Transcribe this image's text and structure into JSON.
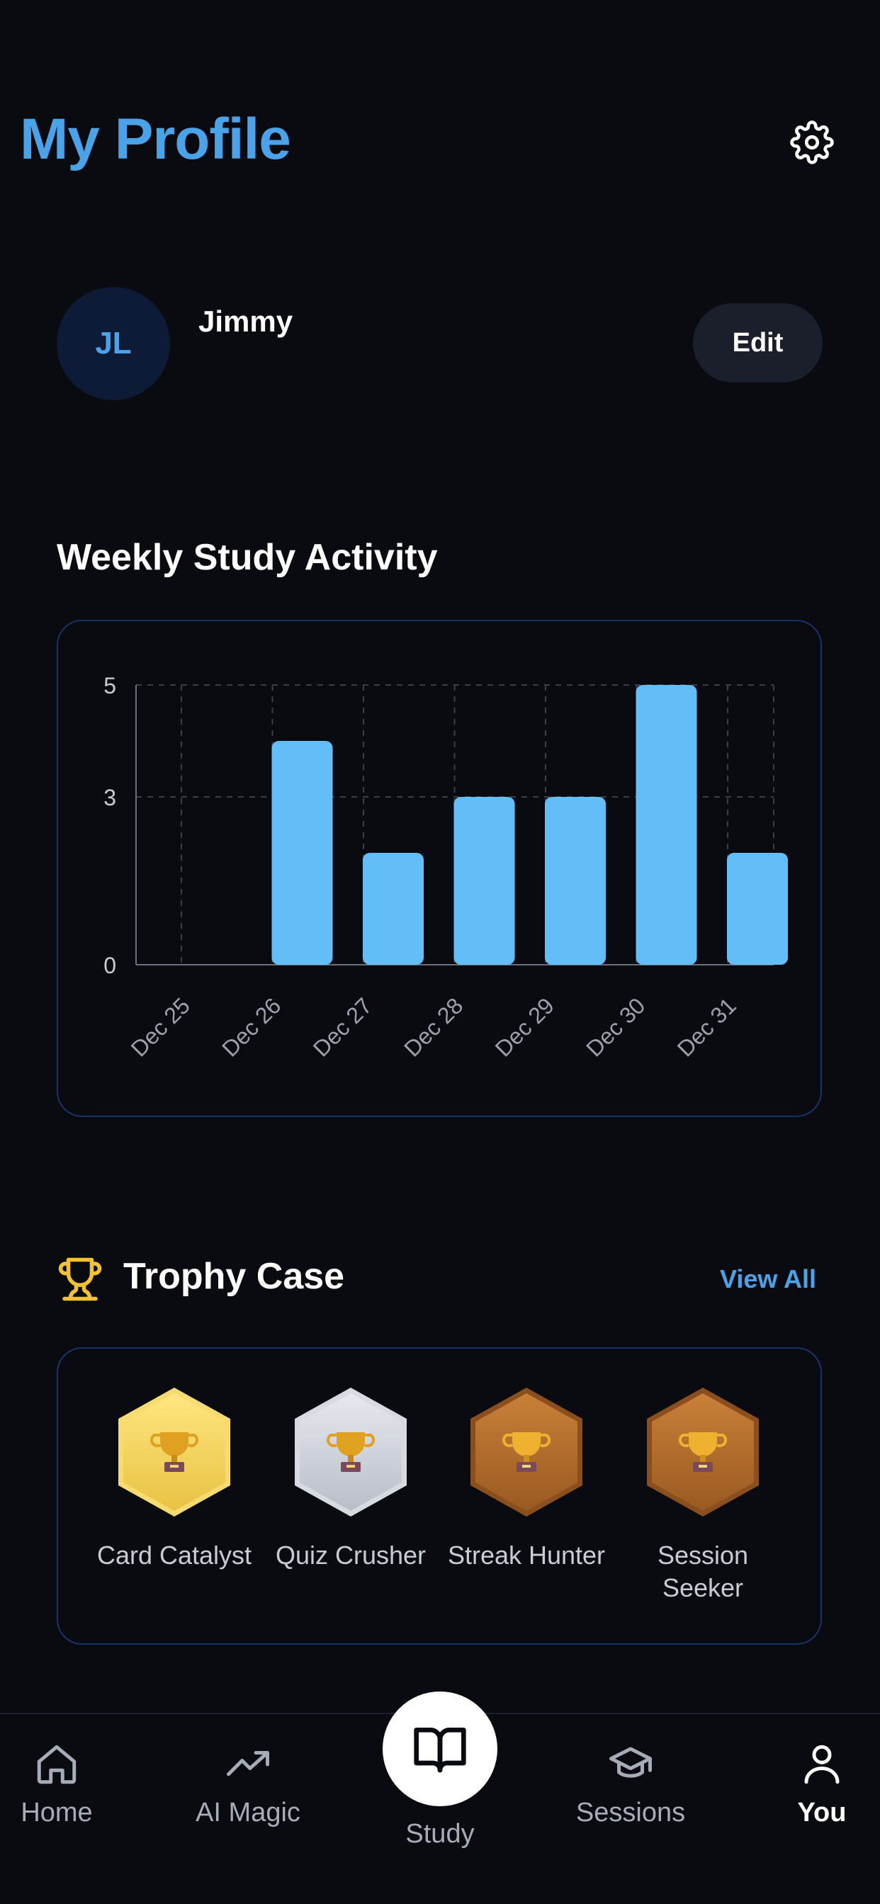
{
  "header": {
    "title": "My Profile",
    "settings_icon": "gear-icon"
  },
  "profile": {
    "initials": "JL",
    "name": "Jimmy",
    "edit_label": "Edit"
  },
  "activity": {
    "section_title": "Weekly Study Activity"
  },
  "chart_data": {
    "type": "bar",
    "categories": [
      "Dec 25",
      "Dec 26",
      "Dec 27",
      "Dec 28",
      "Dec 29",
      "Dec 30",
      "Dec 31"
    ],
    "values": [
      0,
      4,
      2,
      3,
      3,
      5,
      2
    ],
    "y_ticks": [
      0,
      3,
      5
    ],
    "ylim": [
      0,
      5
    ],
    "grid": true,
    "bar_color": "#63bdf6"
  },
  "trophies": {
    "section_title": "Trophy Case",
    "view_all_label": "View All",
    "items": [
      {
        "label": "Card Catalyst",
        "tier": "gold"
      },
      {
        "label": "Quiz Crusher",
        "tier": "silver"
      },
      {
        "label": "Streak Hunter",
        "tier": "bronze"
      },
      {
        "label": "Session Seeker",
        "tier": "bronze"
      }
    ]
  },
  "nav": {
    "items": [
      {
        "label": "Home",
        "icon": "home-icon"
      },
      {
        "label": "AI Magic",
        "icon": "trending-up-icon"
      },
      {
        "label": "Study",
        "icon": "open-book-icon"
      },
      {
        "label": "Sessions",
        "icon": "graduation-cap-icon"
      },
      {
        "label": "You",
        "icon": "user-icon",
        "active": true
      }
    ]
  },
  "colors": {
    "accent": "#4aa3e8",
    "background": "#0a0b10",
    "card_border": "#183368"
  }
}
